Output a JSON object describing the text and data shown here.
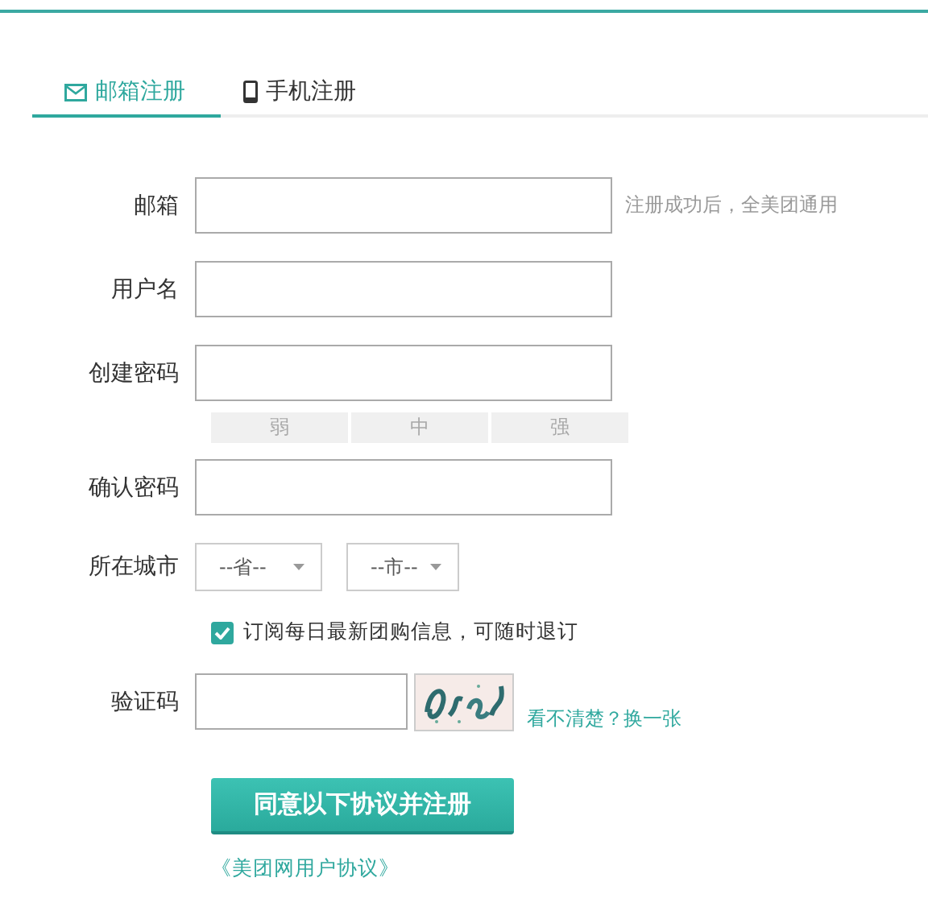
{
  "tabs": [
    {
      "label": "邮箱注册",
      "selected": true
    },
    {
      "label": "手机注册",
      "selected": false
    }
  ],
  "fields": [
    {
      "label": "邮箱",
      "kind": "text",
      "hint": "注册成功后，全美团通用"
    },
    {
      "label": "用户名",
      "kind": "text"
    },
    {
      "label": "创建密码",
      "kind": "password",
      "strength": [
        {
          "label": "弱",
          "active": false
        },
        {
          "label": "中",
          "active": false
        },
        {
          "label": "强",
          "active": false
        }
      ]
    },
    {
      "label": "确认密码",
      "kind": "password"
    },
    {
      "label": "所在城市",
      "kind": "city",
      "selects": [
        "--省--",
        "--市--"
      ]
    }
  ],
  "subscribe": {
    "label": "订阅每日最新团购信息，可随时退订",
    "checked": true
  },
  "captcha": {
    "label": "验证码",
    "refresh": "看不清楚？换一张"
  },
  "submit": "同意以下协议并注册",
  "agreement": "《美团网用户协议》"
}
